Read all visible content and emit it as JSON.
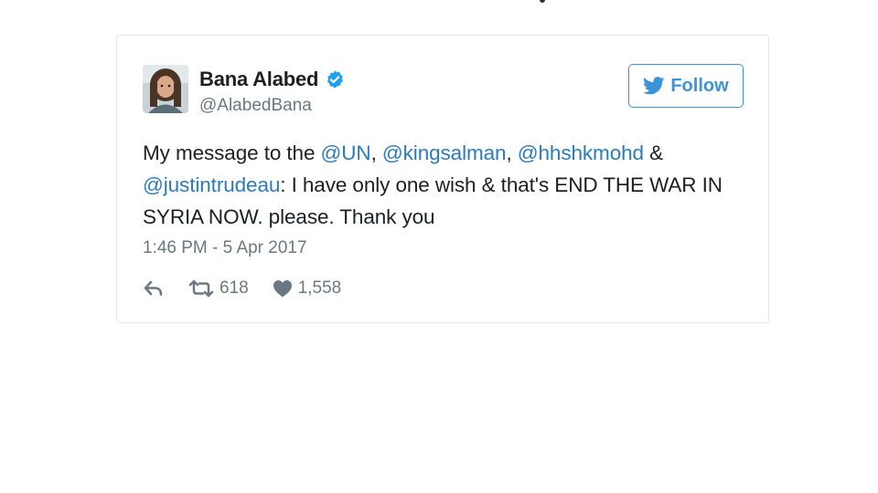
{
  "tweet": {
    "author": {
      "name": "Bana Alabed",
      "handle": "@AlabedBana",
      "avatar_icon": "user-avatar",
      "verified_icon": "verified-badge-icon"
    },
    "follow_label": "Follow",
    "text": {
      "part1": "My message to the ",
      "mention1": "@UN",
      "sep1": ", ",
      "mention2": "@kingsalman",
      "sep2": ", ",
      "mention3": "@hhshkmohd",
      "sep3": " & ",
      "mention4": "@justintrudeau",
      "part2": ": I have only one wish & that's END THE WAR IN SYRIA NOW. please. Thank you"
    },
    "timestamp": "1:46 PM - 5 Apr 2017",
    "actions": {
      "reply_icon": "reply-icon",
      "retweet_icon": "retweet-icon",
      "retweet_count": "618",
      "like_icon": "heart-icon",
      "like_count": "1,558"
    }
  },
  "colors": {
    "accent": "#3b94d9",
    "mention": "#2b7bb9",
    "muted": "#697882",
    "border": "#e1e8ed",
    "verified": "#1da1f2"
  }
}
